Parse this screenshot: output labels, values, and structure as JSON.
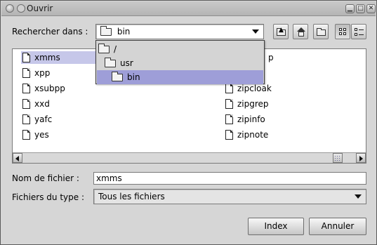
{
  "window": {
    "title": "Ouvrir"
  },
  "look_in": {
    "label": "Rechercher dans :",
    "selected": "bin",
    "options": [
      "/",
      "usr",
      "bin"
    ]
  },
  "toolbar": {
    "icons": [
      "up-folder-icon",
      "home-icon",
      "new-folder-icon",
      "list-view-icon",
      "details-view-icon"
    ]
  },
  "files": {
    "column1": [
      "xmms",
      "xpp",
      "xsubpp",
      "xxd",
      "yafc",
      "yes"
    ],
    "column2_partial": [
      "p"
    ],
    "column2": [
      "zipcloak",
      "zipgrep",
      "zipinfo",
      "zipnote"
    ],
    "selected": "xmms"
  },
  "scrollbar": {
    "position": 0.96
  },
  "filename": {
    "label": "Nom de fichier :",
    "value": "xmms"
  },
  "filetype": {
    "label": "Fichiers du type :",
    "value": "Tous les fichiers"
  },
  "buttons": {
    "open": "Index",
    "cancel": "Annuler"
  },
  "colors": {
    "selection": "#c6c7e9",
    "popup_selection": "#9e9ed8",
    "window_bg": "#d6d6d6"
  }
}
